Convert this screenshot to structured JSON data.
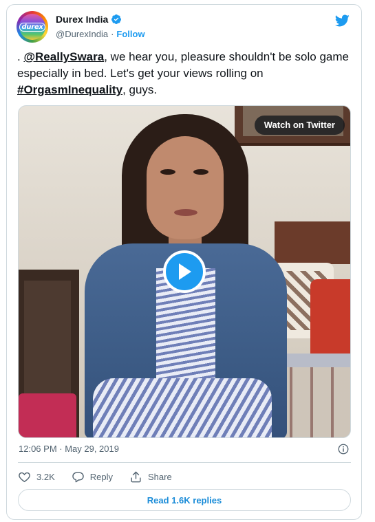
{
  "author": {
    "display_name": "Durex India",
    "handle": "@DurexIndia",
    "separator": "·",
    "follow_label": "Follow",
    "avatar_text": "durex",
    "verified": true
  },
  "tweet": {
    "prefix": ". ",
    "mention": "@ReallySwara",
    "text_1": ", we hear you, pleasure shouldn't be solo game especially in bed. Let's get your views rolling on ",
    "hashtag": "#OrgasmInequality",
    "text_2": ", guys."
  },
  "media": {
    "type": "video",
    "watch_label": "Watch on Twitter"
  },
  "meta": {
    "timestamp": "12:06 PM · May 29, 2019"
  },
  "actions": {
    "likes": "3.2K",
    "reply_label": "Reply",
    "share_label": "Share"
  },
  "read_replies_label": "Read 1.6K replies",
  "colors": {
    "accent": "#1d9bf0",
    "text_primary": "#0f1419",
    "text_secondary": "#536471",
    "border": "#cfd9de"
  }
}
